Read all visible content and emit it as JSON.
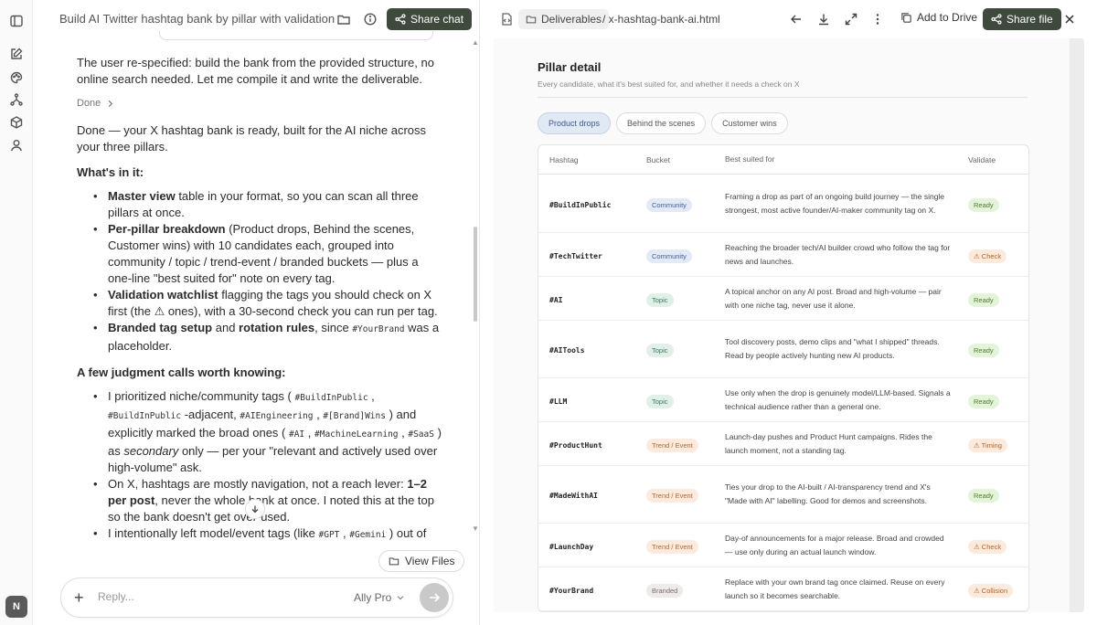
{
  "chat": {
    "title": "Build AI Twitter hashtag bank by pillar with validation",
    "share_label": "Share chat",
    "intro_paragraph": "The user re-specified: build the bank from the provided structure, no online search needed. Let me compile it and write the deliverable.",
    "done_label": "Done",
    "summary": "Done — your X hashtag bank is ready, built for the AI niche across your three pillars.",
    "whats_in_heading": "What's in it:",
    "bullets": [
      {
        "bold": "Master view",
        "text": " table in your format, so you can scan all three pillars at once."
      },
      {
        "bold": "Per-pillar breakdown",
        "text": " (Product drops, Behind the scenes, Customer wins) with 10 candidates each, grouped into community / topic / trend-event / branded buckets — plus a one-line \"best suited for\" note on every tag."
      },
      {
        "bold": "Validation watchlist",
        "text": " flagging the tags you should check on X first (the ⚠ ones), with a 30-second check you can run per tag."
      },
      {
        "bold": "Branded tag setup",
        "mid": " and ",
        "bold2": "rotation rules",
        "text": ", since ",
        "code": "#YourBrand",
        "text2": " was a placeholder."
      }
    ],
    "judgment_heading": "A few judgment calls worth knowing:",
    "judgment": {
      "j1_a": "I prioritized niche/community tags ( ",
      "j1_code1": "#BuildInPublic",
      "j1_b": " , ",
      "j1_code2": "#BuildInPublic",
      "j1_c": " -adjacent, ",
      "j1_code3": "#AIEngineering",
      "j1_d": " , ",
      "j1_code4": "#[Brand]Wins",
      "j1_e": " ) and explicitly marked the broad ones ( ",
      "j1_code5": "#AI",
      "j1_f": " , ",
      "j1_code6": "#MachineLearning",
      "j1_g": " , ",
      "j1_code7": "#SaaS",
      "j1_h": " ) as ",
      "j1_em": "secondary",
      "j1_i": " only — per your \"relevant and actively used over high-volume\" ask.",
      "j2_a": "On X, hashtags are mostly navigation, not a reach lever: ",
      "j2_bold": "1–2 per post",
      "j2_b": ", never the whole bank at once. I noted this at the top so the bank doesn't get over-used.",
      "j3_a": "I intentionally left model/event tags (like ",
      "j3_code1": "#GPT",
      "j3_b": " , ",
      "j3_code2": "#Gemini",
      "j3_c": " ) out of"
    },
    "view_files_label": "View Files",
    "reply_placeholder": "Reply...",
    "model_label": "Ally Pro",
    "avatar_initial": "N"
  },
  "preview": {
    "breadcrumb_folder": "Deliverables",
    "breadcrumb_file": "/ x-hashtag-bank-ai.html",
    "add_to_drive_label": "Add to Drive",
    "share_file_label": "Share file",
    "section_title": "Pillar detail",
    "section_subtitle": "Every candidate, what it's best suited for, and whether it needs a check on X",
    "tabs": [
      "Product drops",
      "Behind the scenes",
      "Customer wins"
    ],
    "active_tab": "Product drops",
    "columns": [
      "Hashtag",
      "Bucket",
      "Best suited for",
      "Validate"
    ],
    "rows": [
      {
        "hashtag": "#BuildInPublic",
        "bucket": "Community",
        "bucket_kind": "community",
        "note": "Framing a drop as part of an ongoing build journey — the single strongest, most active founder/AI-maker community tag on X.",
        "validate": "Ready",
        "validate_kind": "ready"
      },
      {
        "hashtag": "#TechTwitter",
        "bucket": "Community",
        "bucket_kind": "community",
        "note": "Reaching the broader tech/AI builder crowd who follow the tag for news and launches.",
        "validate": "⚠ Check",
        "validate_kind": "warn"
      },
      {
        "hashtag": "#AI",
        "bucket": "Topic",
        "bucket_kind": "topic",
        "note": "A topical anchor on any AI post. Broad and high-volume — pair with one niche tag, never use it alone.",
        "validate": "Ready",
        "validate_kind": "ready"
      },
      {
        "hashtag": "#AITools",
        "bucket": "Topic",
        "bucket_kind": "topic",
        "note": "Tool discovery posts, demo clips and \"what I shipped\" threads. Read by people actively hunting new AI products.",
        "validate": "Ready",
        "validate_kind": "ready"
      },
      {
        "hashtag": "#LLM",
        "bucket": "Topic",
        "bucket_kind": "topic",
        "note": "Use only when the drop is genuinely model/LLM-based. Signals a technical audience rather than a general one.",
        "validate": "Ready",
        "validate_kind": "ready"
      },
      {
        "hashtag": "#ProductHunt",
        "bucket": "Trend / Event",
        "bucket_kind": "trend",
        "note": "Launch-day pushes and Product Hunt campaigns. Rides the launch moment, not a standing tag.",
        "validate": "⚠ Timing",
        "validate_kind": "warn"
      },
      {
        "hashtag": "#MadeWithAI",
        "bucket": "Trend / Event",
        "bucket_kind": "trend",
        "note": "Ties your drop to the AI-built / AI-transparency trend and X's \"Made with AI\" labelling. Good for demos and screenshots.",
        "validate": "Ready",
        "validate_kind": "ready"
      },
      {
        "hashtag": "#LaunchDay",
        "bucket": "Trend / Event",
        "bucket_kind": "trend",
        "note": "Day-of announcements for a major release. Broad and crowded — use only during an actual launch window.",
        "validate": "⚠ Check",
        "validate_kind": "warn"
      },
      {
        "hashtag": "#YourBrand",
        "bucket": "Branded",
        "bucket_kind": "branded",
        "note": "Replace with your own brand tag once claimed. Reuse on every launch so it becomes searchable.",
        "validate": "⚠ Collision",
        "validate_kind": "warn"
      }
    ]
  },
  "colors": {
    "dark_button": "#3d4a3c",
    "active_tab": "#e1e9f5",
    "ready": "#e4f4d9",
    "warn": "#fcebdc"
  }
}
